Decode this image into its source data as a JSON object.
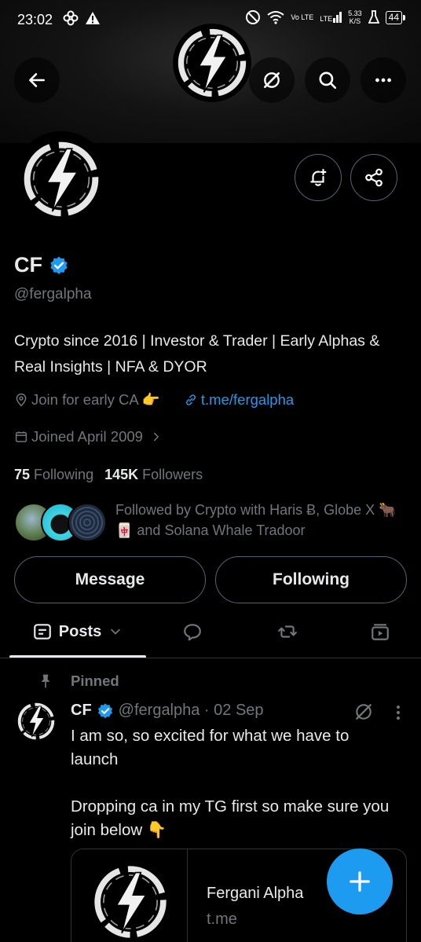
{
  "status_bar": {
    "time": "23:02",
    "net_top": "5.33",
    "net_bottom": "K/S",
    "vo_lte": "Vo LTE",
    "lte": "LTE",
    "battery": "44"
  },
  "header": {
    "icons": [
      "back-arrow-icon",
      "grok-icon",
      "search-icon",
      "more-icon"
    ]
  },
  "profile": {
    "name": "CF",
    "handle": "@fergalpha",
    "bio": "Crypto since 2016 | Investor & Trader | Early Alphas & Real Insights | NFA & DYOR",
    "location": "Join for early CA 👉",
    "link": "t.me/fergalpha",
    "joined": "Joined April 2009",
    "following_count": "75",
    "following_label": "Following",
    "followers_count": "145K",
    "followers_label": "Followers",
    "followed_by": "Followed by Crypto with Haris Ƀ, Globe X 🐂 🀄 and Solana Whale Tradoor"
  },
  "actions": {
    "message": "Message",
    "following": "Following"
  },
  "tabs": {
    "posts": "Posts"
  },
  "post": {
    "pinned_label": "Pinned",
    "name": "CF",
    "handle_date": "@fergalpha · 02 Sep",
    "text": "I am so, so excited for what we have to launch\n\nDropping ca in my TG first so make sure you join below 👇",
    "card_title": "Fergani Alpha",
    "card_domain": "t.me"
  },
  "colors": {
    "accent": "#1d9bf0",
    "text": "#e7e9ea",
    "muted": "#71767b",
    "border": "#2f3336"
  }
}
